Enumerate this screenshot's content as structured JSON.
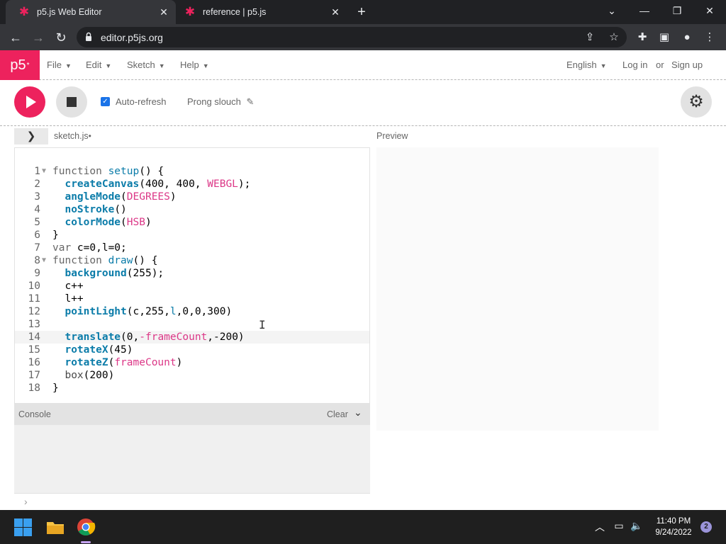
{
  "browser": {
    "tabs": [
      {
        "title": "p5.js Web Editor",
        "active": true
      },
      {
        "title": "reference | p5.js",
        "active": false
      }
    ],
    "url": "editor.p5js.org"
  },
  "app": {
    "logo_text": "p5",
    "logo_sup": "*",
    "menus": [
      "File",
      "Edit",
      "Sketch",
      "Help"
    ],
    "language": "English",
    "login": "Log in",
    "or": "or",
    "signup": "Sign up"
  },
  "toolbar": {
    "auto_refresh_label": "Auto-refresh",
    "auto_refresh_checked": true,
    "sketch_name": "Prong slouch"
  },
  "editor": {
    "file_name": "sketch.js",
    "unsaved_marker": "•",
    "current_line": 14,
    "lines": [
      "function setup() {",
      "  createCanvas(400, 400, WEBGL);",
      "  angleMode(DEGREES)",
      "  noStroke()",
      "  colorMode(HSB)",
      "}",
      "var c=0,l=0;",
      "function draw() {",
      "  background(255);",
      "  c++",
      "  l++",
      "  pointLight(c,255,l,0,0,300)",
      "",
      "  translate(0,-frameCount,-200)",
      "  rotateX(45)",
      "  rotateZ(frameCount)",
      "  box(200)",
      "}"
    ]
  },
  "console": {
    "title": "Console",
    "clear_label": "Clear"
  },
  "preview": {
    "label": "Preview"
  },
  "taskbar": {
    "time": "11:40 PM",
    "date": "9/24/2022",
    "notifications": "2"
  }
}
